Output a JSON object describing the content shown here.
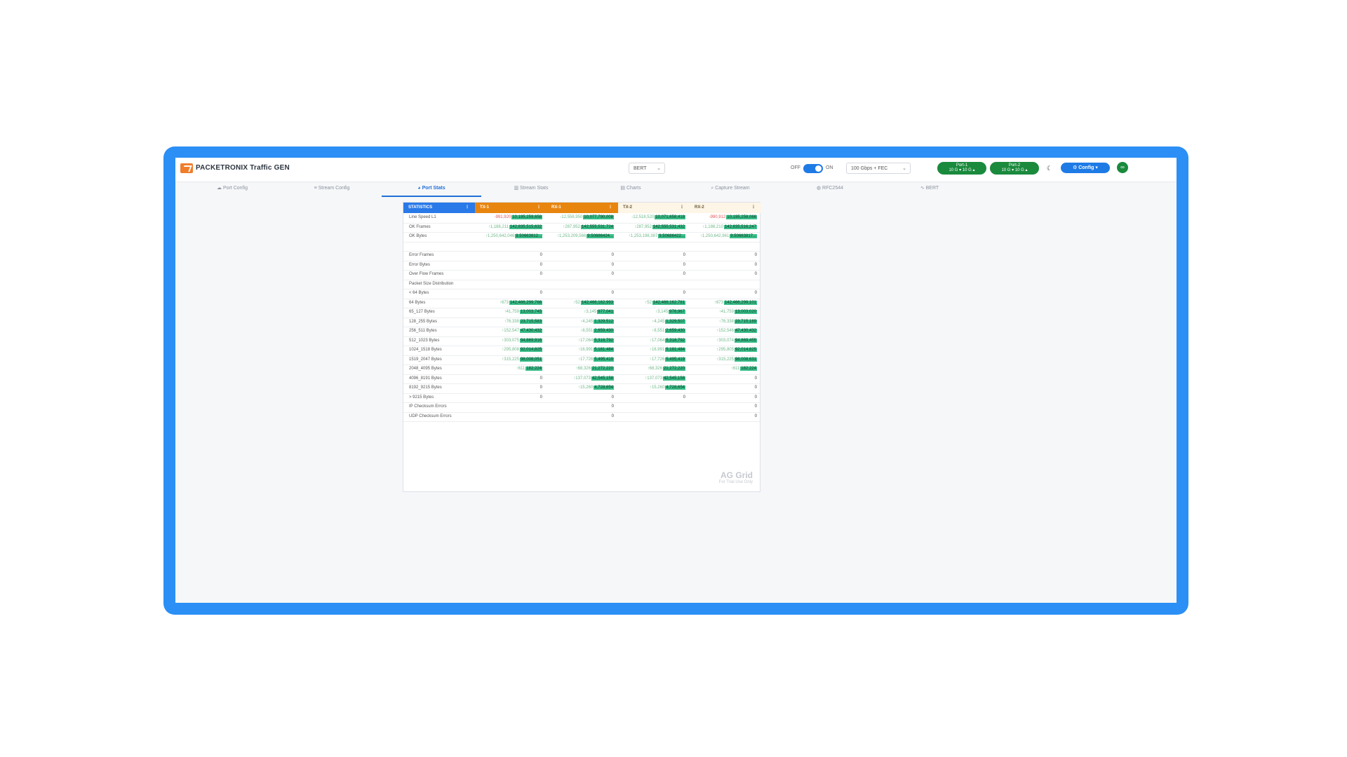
{
  "app": {
    "title": "PACKETRONIX Traffic GEN"
  },
  "header": {
    "mode_select": "BERT",
    "toggle_off": "OFF",
    "toggle_on": "ON",
    "speed_select": "100 Gbps + FEC",
    "ports": [
      {
        "name": "Port-1",
        "detail": "10 G ▾  10 G ▴"
      },
      {
        "name": "Port-2",
        "detail": "10 G ▾  10 G ▴"
      }
    ],
    "config_label": "⚙ Config ▾"
  },
  "tabs": [
    {
      "label": "Port Config",
      "icon": "network-icon"
    },
    {
      "label": "Stream Config",
      "icon": "list-icon"
    },
    {
      "label": "Port Stats",
      "icon": "stats-icon"
    },
    {
      "label": "Stream Stats",
      "icon": "bar-chart-icon"
    },
    {
      "label": "Charts",
      "icon": "chart-icon"
    },
    {
      "label": "Capture Stream",
      "icon": "search-icon"
    },
    {
      "label": "RFC2544",
      "icon": "gauge-icon"
    },
    {
      "label": "BERT",
      "icon": "pulse-icon"
    }
  ],
  "grid": {
    "columns": [
      "STATISTICS",
      "TX-1",
      "RX-1",
      "TX-2",
      "RX-2"
    ],
    "column_colors": [
      "#2979e8",
      "#e8850f",
      "#e8850f",
      "#fdf5e6",
      "#fdf5e6"
    ],
    "rows": [
      {
        "label": "Line Speed L1",
        "cells": [
          {
            "delta": "-991,920",
            "neg": true,
            "value": "10,195,259,658"
          },
          {
            "delta": "-12,558,950",
            "neg": false,
            "value": "10,077,790,008"
          },
          {
            "delta": "-12,518,520",
            "neg": false,
            "value": "10,071,658,418"
          },
          {
            "delta": "-990,912",
            "neg": true,
            "value": "10,195,258,066"
          }
        ]
      },
      {
        "label": "OK Frames",
        "cells": [
          {
            "delta": "↑1,188,211",
            "neg": false,
            "value": "142,835,515,632"
          },
          {
            "delta": "↑287,952",
            "neg": false,
            "value": "142,555,531,724"
          },
          {
            "delta": "↑287,952",
            "neg": false,
            "value": "142,555,531,432"
          },
          {
            "delta": "↑1,188,210",
            "neg": false,
            "value": "142,835,516,247"
          }
        ]
      },
      {
        "label": "OK Bytes",
        "cells": [
          {
            "delta": "↑1,250,642,046",
            "neg": false,
            "value": "9.50663812..."
          },
          {
            "delta": "↑1,253,209,566",
            "neg": false,
            "value": "9.50686424..."
          },
          {
            "delta": "↑1,253,198,387",
            "neg": false,
            "value": "9.50686422..."
          },
          {
            "delta": "↑1,250,642,961",
            "neg": false,
            "value": "9.50663817..."
          }
        ]
      },
      {
        "label": "",
        "cells": [
          {
            "value": ""
          },
          {
            "value": ""
          },
          {
            "value": ""
          },
          {
            "value": ""
          }
        ]
      },
      {
        "label": "Error Frames",
        "cells": [
          {
            "value": "0"
          },
          {
            "value": "0"
          },
          {
            "value": "0"
          },
          {
            "value": "0"
          }
        ]
      },
      {
        "label": "Error Bytes",
        "cells": [
          {
            "value": "0"
          },
          {
            "value": "0"
          },
          {
            "value": "0"
          },
          {
            "value": "0"
          }
        ]
      },
      {
        "label": "Over Flow Frames",
        "cells": [
          {
            "value": "0"
          },
          {
            "value": "0"
          },
          {
            "value": "0"
          },
          {
            "value": "0"
          }
        ]
      },
      {
        "label": "Packet Size Distribution",
        "cells": [
          {
            "value": ""
          },
          {
            "value": ""
          },
          {
            "value": ""
          },
          {
            "value": ""
          }
        ]
      },
      {
        "label": "< 64 Bytes",
        "cells": [
          {
            "value": "0"
          },
          {
            "value": "0"
          },
          {
            "value": "0"
          },
          {
            "value": "0"
          }
        ]
      },
      {
        "label": "64 Bytes",
        "cells": [
          {
            "delta": "↑673",
            "value": "142,466,299,766"
          },
          {
            "delta": "↑52",
            "value": "142,466,162,993"
          },
          {
            "delta": "↑52",
            "value": "142,466,162,781"
          },
          {
            "delta": "↑673",
            "value": "142,466,299,101"
          }
        ]
      },
      {
        "label": "65_127 Bytes",
        "cells": [
          {
            "delta": "↑41,759",
            "value": "13,003,745"
          },
          {
            "delta": "↑3,145",
            "value": "977,041"
          },
          {
            "delta": "↑3,145",
            "value": "976,967"
          },
          {
            "delta": "↑41,759",
            "value": "13,003,020"
          }
        ]
      },
      {
        "label": "128_255 Bytes",
        "cells": [
          {
            "delta": "↑76,338",
            "value": "23,715,583"
          },
          {
            "delta": "↑4,245",
            "value": "1,329,512"
          },
          {
            "delta": "↑4,245",
            "value": "1,329,507"
          },
          {
            "delta": "↑76,338",
            "value": "23,715,189"
          }
        ]
      },
      {
        "label": "256_511 Bytes",
        "cells": [
          {
            "delta": "↑152,547",
            "value": "47,430,432"
          },
          {
            "delta": "↑8,551",
            "value": "2,659,430"
          },
          {
            "delta": "↑8,551",
            "value": "2,659,430"
          },
          {
            "delta": "↑152,546",
            "value": "47,430,432"
          }
        ]
      },
      {
        "label": "512_1023 Bytes",
        "cells": [
          {
            "delta": "↑303,075",
            "value": "94,869,916"
          },
          {
            "delta": "↑17,064",
            "value": "5,318,792"
          },
          {
            "delta": "↑17,064",
            "value": "5,318,792"
          },
          {
            "delta": "↑303,074",
            "value": "94,869,455"
          }
        ]
      },
      {
        "label": "1024_1518 Bytes",
        "cells": [
          {
            "delta": "↑295,808",
            "value": "92,014,825"
          },
          {
            "delta": "↑16,991",
            "value": "5,181,484"
          },
          {
            "delta": "↑16,991",
            "value": "5,181,484"
          },
          {
            "delta": "↑295,805",
            "value": "92,014,825"
          }
        ]
      },
      {
        "label": "1519_2047 Bytes",
        "cells": [
          {
            "delta": "↑315,225",
            "value": "98,008,051"
          },
          {
            "delta": "↑17,726",
            "value": "5,495,419"
          },
          {
            "delta": "↑17,726",
            "value": "5,495,419"
          },
          {
            "delta": "↑315,225",
            "value": "98,008,631"
          }
        ]
      },
      {
        "label": "2048_4095 Bytes",
        "cells": [
          {
            "delta": "↑611",
            "value": "182,224"
          },
          {
            "delta": "↑68,326",
            "value": "21,272,220"
          },
          {
            "delta": "↑68,326",
            "value": "21,272,220"
          },
          {
            "delta": "↑611",
            "value": "182,224"
          }
        ]
      },
      {
        "label": "4096_8191 Bytes",
        "cells": [
          {
            "value": "0"
          },
          {
            "delta": "↑137,073",
            "value": "42,545,158"
          },
          {
            "delta": "↑137,073",
            "value": "42,545,158"
          },
          {
            "value": "0"
          }
        ]
      },
      {
        "label": "8192_9215 Bytes",
        "cells": [
          {
            "value": "0"
          },
          {
            "delta": "↑15,260",
            "value": "4,728,654"
          },
          {
            "delta": "↑15,260",
            "value": "4,728,654"
          },
          {
            "value": "0"
          }
        ]
      },
      {
        "label": "> 9215 Bytes",
        "cells": [
          {
            "value": "0"
          },
          {
            "value": "0"
          },
          {
            "value": "0"
          },
          {
            "value": "0"
          }
        ]
      },
      {
        "label": "IP Checksum Errors",
        "cells": [
          {
            "value": ""
          },
          {
            "value": "0"
          },
          {
            "value": ""
          },
          {
            "value": "0"
          }
        ]
      },
      {
        "label": "UDP Checksum Errors",
        "cells": [
          {
            "value": ""
          },
          {
            "value": "0"
          },
          {
            "value": ""
          },
          {
            "value": "0"
          }
        ]
      }
    ],
    "watermark": "AG Grid",
    "watermark_sub": "For Trial Use Only"
  }
}
